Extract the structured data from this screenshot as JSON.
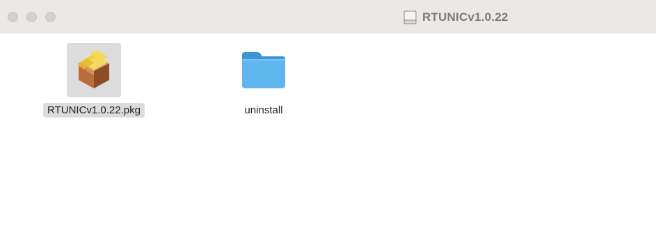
{
  "window": {
    "title": "RTUNICv1.0.22",
    "title_icon": "disk-image-icon"
  },
  "traffic_lights": {
    "color": "#d3d1d0",
    "buttons": [
      "close",
      "minimize",
      "zoom"
    ]
  },
  "files": [
    {
      "name": "RTUNICv1.0.22.pkg",
      "icon": "package-icon",
      "selected": true
    },
    {
      "name": "uninstall",
      "icon": "folder-icon",
      "selected": false
    }
  ],
  "colors": {
    "titlebar": "#ebe9e8",
    "selection": "#dcdcdc",
    "folder": "#5fb6ee"
  }
}
